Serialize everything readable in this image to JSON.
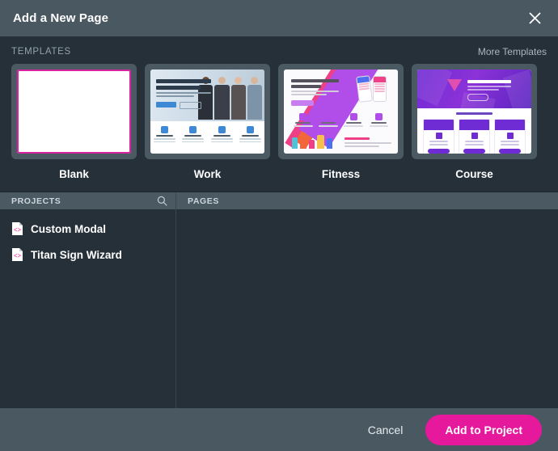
{
  "dialog": {
    "title": "Add a New Page",
    "close_icon": "close-icon"
  },
  "templates": {
    "section_label": "TEMPLATES",
    "more_link": "More Templates",
    "items": [
      {
        "label": "Blank",
        "selected": true,
        "art": "blank"
      },
      {
        "label": "Work",
        "selected": false,
        "art": "work",
        "headline": "Perfect work Perfect Office"
      },
      {
        "label": "Fitness",
        "selected": false,
        "art": "fitness",
        "headline": "Your Fitness Tracker",
        "section": "50+ Classes"
      },
      {
        "label": "Course",
        "selected": false,
        "art": "course",
        "headline": "Are you DIGITAL?",
        "section": "Courses of 2020"
      }
    ]
  },
  "projects": {
    "panel_label": "PROJECTS",
    "search_icon": "search-icon",
    "items": [
      {
        "name": "Custom Modal",
        "icon": "code-file-icon"
      },
      {
        "name": "Titan Sign Wizard",
        "icon": "code-file-icon"
      }
    ]
  },
  "pages": {
    "panel_label": "PAGES",
    "items": []
  },
  "footer": {
    "cancel_label": "Cancel",
    "add_label": "Add to Project"
  },
  "colors": {
    "accent": "#e6189c",
    "selected_border": "#d822a0",
    "header_bg": "#4a5861",
    "panel_bg": "#263039",
    "panel_head_bg": "#4a5962"
  }
}
